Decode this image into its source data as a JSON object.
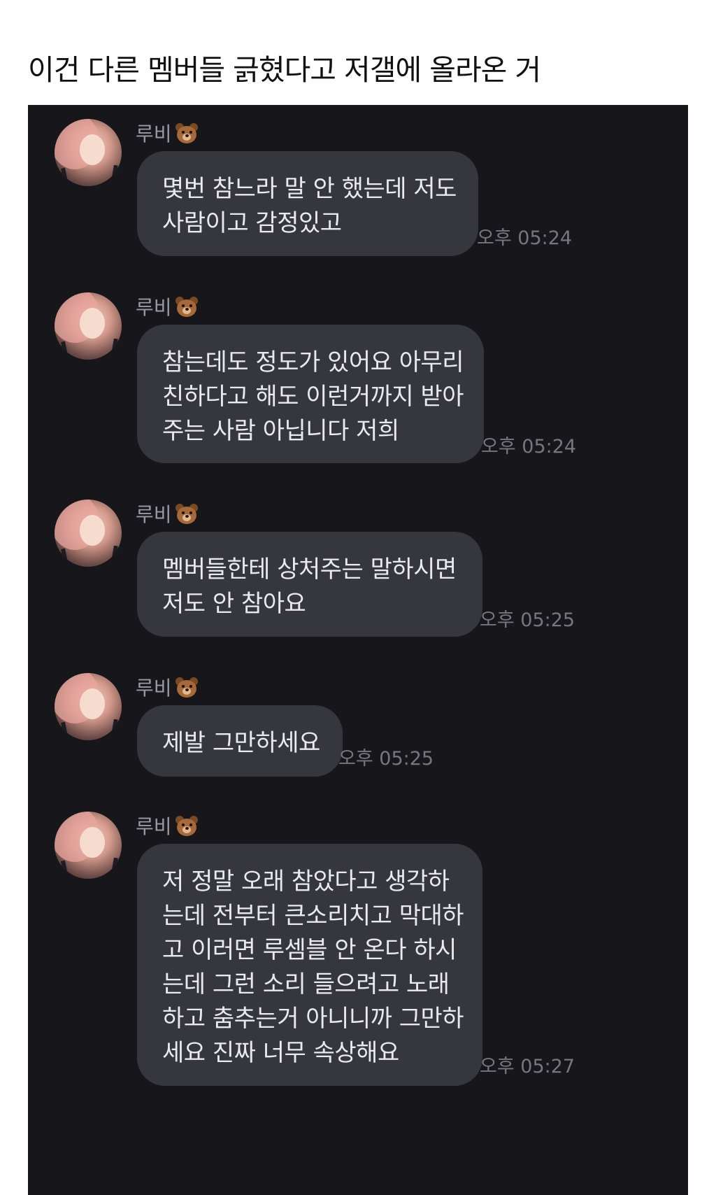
{
  "post": {
    "title": "이건 다른 멤버들 긁혔다고 저갤에 올라온 거"
  },
  "colors": {
    "chat_background": "#17171b",
    "bubble": "#36373d",
    "bubble_text": "#e9e9ee",
    "name_text": "#9a9aa2",
    "time_text": "#76767e"
  },
  "messages": [
    {
      "sender": "루비",
      "sender_icon": "bear-face-emoji",
      "lines": [
        "몇번 참느라 말 안 했는데 저도",
        "사람이고 감정있고"
      ],
      "time": "오후 05:24"
    },
    {
      "sender": "루비",
      "sender_icon": "bear-face-emoji",
      "lines": [
        "참는데도 정도가 있어요 아무리",
        "친하다고 해도 이런거까지 받아",
        "주는 사람 아닙니다 저희"
      ],
      "time": "오후 05:24"
    },
    {
      "sender": "루비",
      "sender_icon": "bear-face-emoji",
      "lines": [
        "멤버들한테 상처주는 말하시면",
        "저도 안 참아요"
      ],
      "time": "오후 05:25"
    },
    {
      "sender": "루비",
      "sender_icon": "bear-face-emoji",
      "lines": [
        "제발 그만하세요"
      ],
      "time": "오후 05:25"
    },
    {
      "sender": "루비",
      "sender_icon": "bear-face-emoji",
      "lines": [
        "저 정말 오래 참았다고 생각하",
        "는데 전부터 큰소리치고 막대하",
        "고 이러면 루셈블 안 온다 하시",
        "는데 그런 소리 들으려고 노래",
        "하고 춤추는거 아니니까 그만하",
        "세요 진짜 너무 속상해요"
      ],
      "time": "오후 05:27"
    }
  ]
}
